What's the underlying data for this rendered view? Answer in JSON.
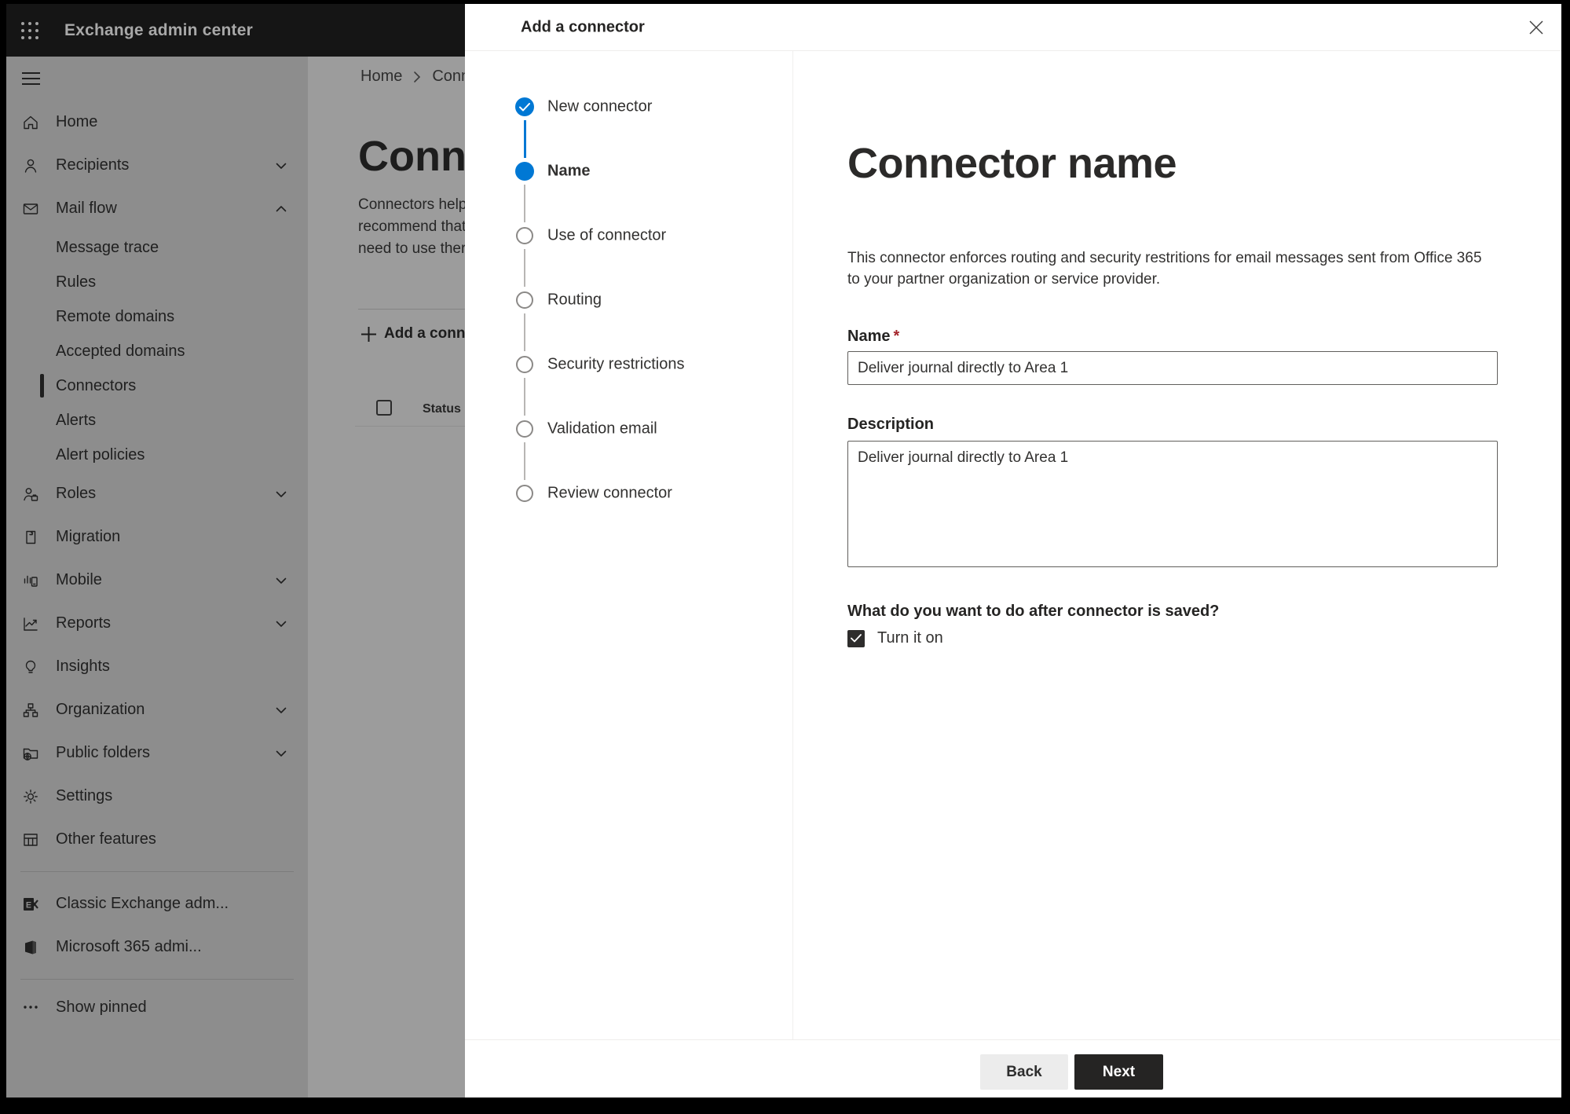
{
  "topbar": {
    "title": "Exchange admin center"
  },
  "sidebar": {
    "items": [
      {
        "label": "Home",
        "icon": "home"
      },
      {
        "label": "Recipients",
        "icon": "person",
        "chevron": "down"
      },
      {
        "label": "Mail flow",
        "icon": "mail",
        "chevron": "up",
        "children": [
          "Message trace",
          "Rules",
          "Remote domains",
          "Accepted domains",
          "Connectors",
          "Alerts",
          "Alert policies"
        ],
        "selected_child": "Connectors"
      },
      {
        "label": "Roles",
        "icon": "roles",
        "chevron": "down"
      },
      {
        "label": "Migration",
        "icon": "migration"
      },
      {
        "label": "Mobile",
        "icon": "mobile",
        "chevron": "down"
      },
      {
        "label": "Reports",
        "icon": "reports",
        "chevron": "down"
      },
      {
        "label": "Insights",
        "icon": "insights"
      },
      {
        "label": "Organization",
        "icon": "organization",
        "chevron": "down"
      },
      {
        "label": "Public folders",
        "icon": "public-folders",
        "chevron": "down"
      },
      {
        "label": "Settings",
        "icon": "settings"
      },
      {
        "label": "Other features",
        "icon": "other-features"
      }
    ],
    "footer_items": [
      {
        "label": "Classic Exchange adm...",
        "icon": "exchange-logo"
      },
      {
        "label": "Microsoft 365 admi...",
        "icon": "m365-logo"
      }
    ],
    "show_pinned_label": "Show pinned"
  },
  "background_page": {
    "breadcrumb_home": "Home",
    "breadcrumb_current": "Conne",
    "title": "Connec",
    "paragraph_lines": [
      "Connectors help",
      "recommend that",
      "need to use ther"
    ],
    "add_button_label": "Add a conn",
    "table_header_status": "Status"
  },
  "dialog": {
    "title": "Add a connector",
    "steps": [
      {
        "label": "New connector",
        "state": "completed"
      },
      {
        "label": "Name",
        "state": "current"
      },
      {
        "label": "Use of connector",
        "state": "upcoming"
      },
      {
        "label": "Routing",
        "state": "upcoming"
      },
      {
        "label": "Security restrictions",
        "state": "upcoming"
      },
      {
        "label": "Validation email",
        "state": "upcoming"
      },
      {
        "label": "Review connector",
        "state": "upcoming"
      }
    ],
    "heading": "Connector name",
    "description_lines": [
      "This connector enforces routing and security restritions for email messages sent from Office 365",
      "to your partner organization or service provider."
    ],
    "name_label": "Name",
    "required_marker": "*",
    "name_value": "Deliver journal directly to Area 1",
    "description_label": "Description",
    "description_value": "Deliver journal directly to Area 1",
    "question": "What do you want to do after connector is saved?",
    "checkbox_label": "Turn it on",
    "checkbox_checked": true,
    "back_label": "Back",
    "next_label": "Next"
  },
  "colors": {
    "accent_blue": "#0078d4",
    "required_red": "#a4262c",
    "next_button_bg": "#252423",
    "back_button_bg": "#ececec",
    "dimmed_sidebar_bg": "#8d8d8d",
    "dimmed_page_bg": "#9c9c9c",
    "topbar_bg": "#151515"
  }
}
